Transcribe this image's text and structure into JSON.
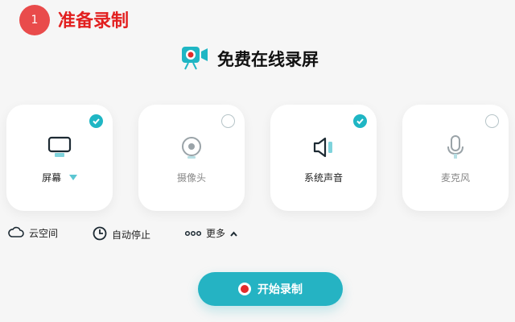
{
  "step": {
    "number": "1",
    "title": "准备录制"
  },
  "app": {
    "title": "免费在线录屏"
  },
  "options": [
    {
      "label": "屏幕",
      "checked": true,
      "icon": "monitor-icon"
    },
    {
      "label": "摄像头",
      "checked": false,
      "icon": "webcam-icon"
    },
    {
      "label": "系统声音",
      "checked": true,
      "icon": "speaker-icon"
    },
    {
      "label": "麦克风",
      "checked": false,
      "icon": "microphone-icon"
    }
  ],
  "toolbar": {
    "cloud": "云空间",
    "auto_stop": "自动停止",
    "more": "更多"
  },
  "start_button": {
    "label": "开始录制"
  },
  "colors": {
    "accent": "#25b3c3",
    "red": "#e21f1f",
    "badge": "#e94b4b"
  }
}
